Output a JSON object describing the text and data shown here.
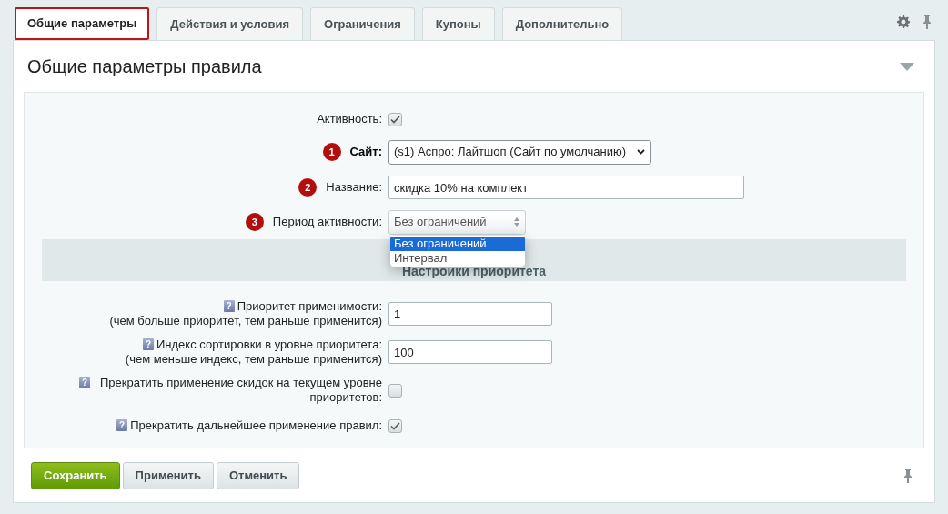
{
  "tabs": [
    {
      "label": "Общие параметры",
      "selected": true
    },
    {
      "label": "Действия и условия",
      "selected": false
    },
    {
      "label": "Ограничения",
      "selected": false
    },
    {
      "label": "Купоны",
      "selected": false
    },
    {
      "label": "Дополнительно",
      "selected": false
    }
  ],
  "panel": {
    "title": "Общие параметры правила",
    "rows": [
      {
        "kind": "checkbox",
        "label": "Активность:",
        "checked": true
      },
      {
        "kind": "select",
        "label": "Сайт:",
        "bold": true,
        "badge": "1",
        "value": "(s1) Аспро: Лайтшоп (Сайт по умолчанию)"
      },
      {
        "kind": "text",
        "label": "Название:",
        "badge": "2",
        "value": "скидка 10% на комплект"
      },
      {
        "kind": "period",
        "label": "Период активности:",
        "badge": "3",
        "value": "Без ограничений",
        "expanded": true,
        "options": [
          {
            "label": "Без ограничений",
            "selected": true
          },
          {
            "label": "Интервал",
            "selected": false
          }
        ]
      }
    ],
    "section": "Настройки приоритета",
    "priority_rows": [
      {
        "kind": "text",
        "help": "?",
        "label": "Приоритет применимости:",
        "hint": "(чем больше приоритет, тем раньше применится)",
        "value": "1"
      },
      {
        "kind": "text",
        "help": "?",
        "label": "Индекс сортировки в уровне приоритета:",
        "hint": "(чем меньше индекс, тем раньше применится)",
        "value": "100"
      },
      {
        "kind": "checkbox",
        "help": "?",
        "label": "Прекратить применение скидок на текущем уровне приоритетов:",
        "checked": false
      },
      {
        "kind": "checkbox",
        "help": "?",
        "label": "Прекратить дальнейшее применение правил:",
        "checked": true
      }
    ]
  },
  "buttons": [
    {
      "label": "Сохранить",
      "kind": "primary"
    },
    {
      "label": "Применить",
      "kind": "normal"
    },
    {
      "label": "Отменить",
      "kind": "normal"
    }
  ]
}
